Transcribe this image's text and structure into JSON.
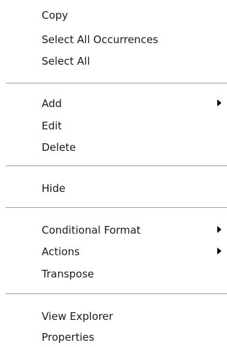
{
  "context_menu": {
    "groups": [
      {
        "items": [
          {
            "label": "Copy"
          },
          {
            "label": "Select All Occurrences"
          },
          {
            "label": "Select All"
          }
        ]
      },
      {
        "items": [
          {
            "label": "Add",
            "icon": "chevron-right-icon"
          },
          {
            "label": "Edit"
          },
          {
            "label": "Delete"
          }
        ]
      },
      {
        "items": [
          {
            "label": "Hide"
          }
        ]
      },
      {
        "items": [
          {
            "label": "Conditional Format",
            "icon": "chevron-right-icon"
          },
          {
            "label": "Actions",
            "icon": "chevron-right-icon"
          },
          {
            "label": "Transpose"
          }
        ]
      },
      {
        "items": [
          {
            "label": "View Explorer"
          },
          {
            "label": "Properties"
          }
        ]
      }
    ]
  }
}
